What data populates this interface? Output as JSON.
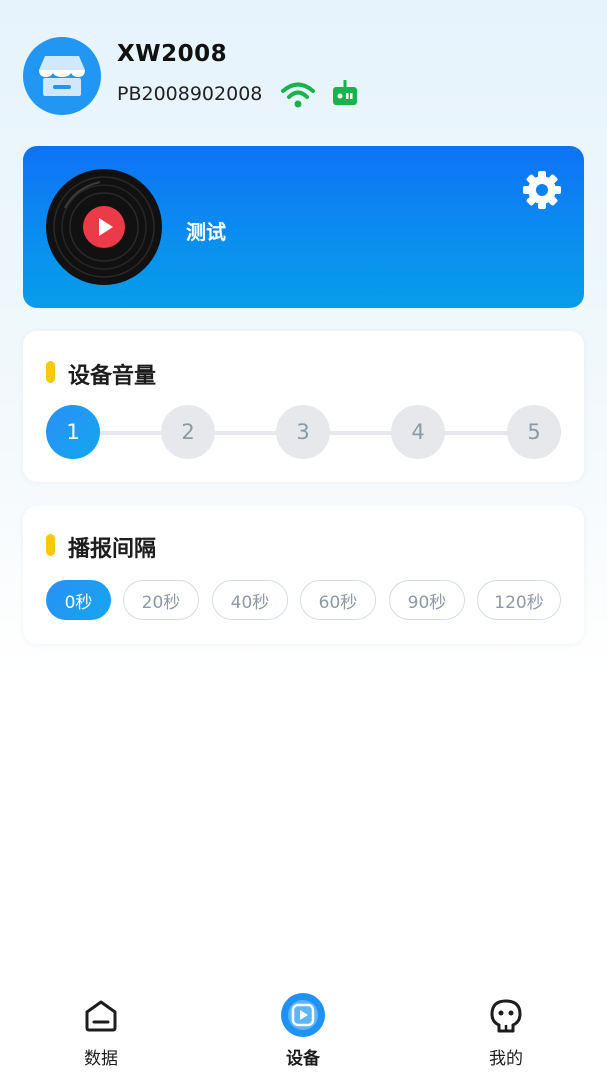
{
  "header": {
    "shop_name": "XW2008",
    "shop_id": "PB2008902008"
  },
  "player": {
    "label": "测试"
  },
  "volume": {
    "title": "设备音量",
    "steps": [
      "1",
      "2",
      "3",
      "4",
      "5"
    ],
    "selected": "1"
  },
  "interval": {
    "title": "播报间隔",
    "options": [
      "0秒",
      "20秒",
      "40秒",
      "60秒",
      "90秒",
      "120秒"
    ],
    "selected": "0秒"
  },
  "nav": {
    "items": [
      {
        "label": "数据",
        "icon": "home-icon"
      },
      {
        "label": "设备",
        "icon": "device-play-icon"
      },
      {
        "label": "我的",
        "icon": "user-icon"
      }
    ],
    "active": "设备"
  },
  "colors": {
    "accent": "#1890f5",
    "highlight_bar": "#f7c80c",
    "wifi_green": "#19b34d"
  }
}
